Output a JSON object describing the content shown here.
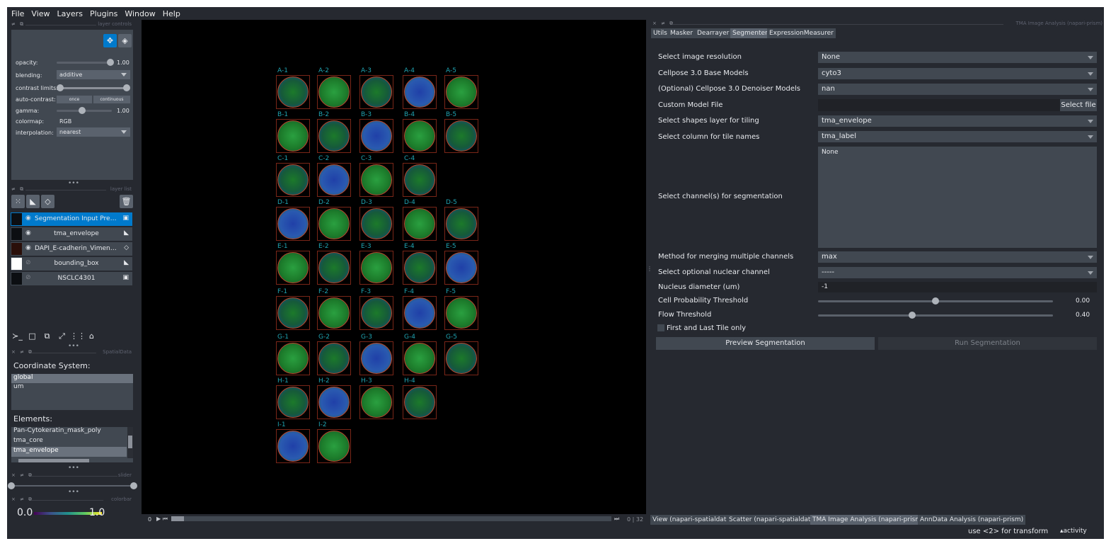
{
  "menu": [
    "File",
    "View",
    "Layers",
    "Plugins",
    "Window",
    "Help"
  ],
  "layer_controls": {
    "title": "layer controls",
    "opacity_label": "opacity:",
    "opacity_value": "1.00",
    "opacity": 1.0,
    "blending_label": "blending:",
    "blending_value": "additive",
    "contrast_label": "contrast limits:",
    "autocontrast_label": "auto-contrast:",
    "once_label": "once",
    "continuous_label": "continuous",
    "gamma_label": "gamma:",
    "gamma_value": "1.00",
    "colormap_label": "colormap:",
    "colormap_value": "RGB",
    "interpolation_label": "interpolation:",
    "interpolation_value": "nearest"
  },
  "layer_list": {
    "title": "layer list",
    "layers": [
      {
        "name": "Segmentation Input Preview",
        "type_icon": "image-icon",
        "visible": true,
        "selected": true
      },
      {
        "name": "tma_envelope",
        "type_icon": "shapes-icon",
        "visible": true,
        "selected": false
      },
      {
        "name": "DAPI_E-cadherin_Vimentin...",
        "type_icon": "label-icon",
        "visible": true,
        "selected": false
      },
      {
        "name": "bounding_box",
        "type_icon": "shapes-icon",
        "visible": false,
        "selected": false
      },
      {
        "name": "NSCLC4301",
        "type_icon": "image-icon",
        "visible": false,
        "selected": false
      }
    ]
  },
  "spatialdata": {
    "title": "SpatialData",
    "coord_label": "Coordinate System:",
    "coords": [
      "global",
      "um"
    ],
    "coord_selected": "global",
    "elements_label": "Elements:",
    "elements": [
      "Pan-Cytokeratin_mask_poly",
      "tma_core",
      "tma_envelope"
    ],
    "element_selected": "tma_envelope"
  },
  "slider_panel": {
    "title": "slider"
  },
  "colorbar": {
    "title": "colorbar",
    "min": "0.0",
    "max": "1.0"
  },
  "dims": {
    "current": "0",
    "total": "32"
  },
  "tma_labels": [
    "A-1",
    "A-2",
    "A-3",
    "A-4",
    "A-5",
    "B-1",
    "B-2",
    "B-3",
    "B-4",
    "B-5",
    "C-1",
    "C-2",
    "C-3",
    "C-4",
    "D-1",
    "D-2",
    "D-3",
    "D-4",
    "D-5",
    "E-1",
    "E-2",
    "E-3",
    "E-4",
    "E-5",
    "F-1",
    "F-2",
    "F-3",
    "F-4",
    "F-5",
    "G-1",
    "G-2",
    "G-3",
    "G-4",
    "G-5",
    "H-1",
    "H-2",
    "H-3",
    "H-4",
    "I-1",
    "I-2"
  ],
  "right_dock": {
    "title": "TMA Image Analysis (napari-prism)",
    "tabs": [
      "Utils",
      "Masker",
      "Dearrayer",
      "Segmenter",
      "ExpressionMeasurer"
    ],
    "active_tab": "Segmenter",
    "fields": {
      "resolution_label": "Select image resolution",
      "resolution_value": "None",
      "base_models_label": "Cellpose 3.0 Base Models",
      "base_models_value": "cyto3",
      "denoiser_label": "(Optional) Cellpose 3.0 Denoiser Models",
      "denoiser_value": "nan",
      "custom_model_label": "Custom Model File",
      "select_file_label": "Select file",
      "shapes_layer_label": "Select shapes layer for tiling",
      "shapes_layer_value": "tma_envelope",
      "tile_column_label": "Select column for tile names",
      "tile_column_value": "tma_label",
      "channels_label": "Select channel(s) for segmentation",
      "channels_value": "None",
      "merge_label": "Method for merging multiple channels",
      "merge_value": "max",
      "nuclear_label": "Select optional nuclear channel",
      "nuclear_value": "-----",
      "diameter_label": "Nucleus diameter (um)",
      "diameter_value": "-1",
      "cellprob_label": "Cell Probability Threshold",
      "cellprob_value": "0.00",
      "cellprob_fraction": 0.5,
      "flow_label": "Flow Threshold",
      "flow_value": "0.40",
      "flow_fraction": 0.4,
      "first_last_label": "First and Last Tile only",
      "preview_button": "Preview Segmentation",
      "run_button": "Run Segmentation"
    }
  },
  "bottom_tabs": [
    "View (napari-spatialdata)",
    "Scatter (napari-spatialdata)",
    "TMA Image Analysis (napari-prism)",
    "AnnData Analysis (napari-prism)"
  ],
  "active_bottom_tab": "TMA Image Analysis (napari-prism)",
  "status": {
    "hint": "use <2> for transform",
    "activity": "activity"
  }
}
